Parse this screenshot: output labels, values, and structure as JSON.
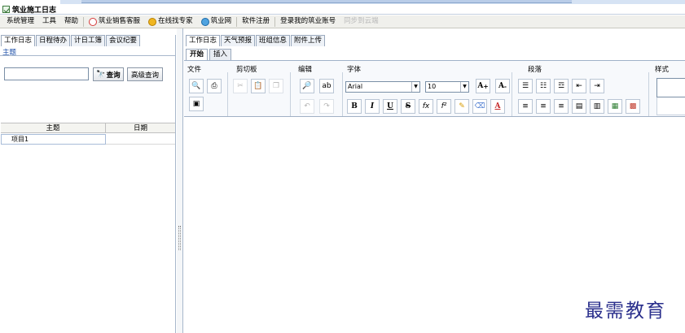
{
  "window": {
    "title": "筑业施工日志"
  },
  "menubar": {
    "items": [
      "系统管理",
      "工具",
      "帮助"
    ],
    "links": [
      {
        "label": "筑业销售客服",
        "icon": "customer-service-icon"
      },
      {
        "label": "在线找专家",
        "icon": "expert-icon"
      },
      {
        "label": "筑业网",
        "icon": "zhuye-icon"
      }
    ],
    "register": "软件注册",
    "login": "登录我的筑业账号",
    "sync": "同步到云端"
  },
  "left": {
    "tabs": [
      "工作日志",
      "日程待办",
      "计日工簿",
      "会议纪要"
    ],
    "active_tab": 0,
    "group_label": "主题",
    "search": {
      "value": "",
      "placeholder": ""
    },
    "query_button": "查询",
    "advanced_button": "高级查询",
    "table": {
      "columns": [
        "主题",
        "日期"
      ],
      "rows": [
        {
          "subject": "项目1",
          "date": ""
        }
      ]
    }
  },
  "right": {
    "tabs": [
      "工作日志",
      "天气预报",
      "班组信息",
      "附件上传"
    ],
    "active_tab": 0,
    "ribbon_tabs": [
      "开始",
      "插入"
    ],
    "active_ribbon_tab": 0,
    "groups": {
      "file": "文件",
      "clipboard": "剪切板",
      "edit": "编辑",
      "font": "字体",
      "paragraph": "段落",
      "style": "样式"
    },
    "font_name": "Arial",
    "font_size": "10",
    "buttons": {
      "bold": "B",
      "italic": "I",
      "underline": "U",
      "strike": "S",
      "subscript": "fx",
      "superscript": "f²",
      "grow": "A",
      "shrink": "A"
    }
  },
  "watermark": "最需教育",
  "colors": {
    "accent": "#1c4fa8",
    "watermark": "#2a2f8c",
    "ribbon_bg": "#f7f9fc"
  }
}
